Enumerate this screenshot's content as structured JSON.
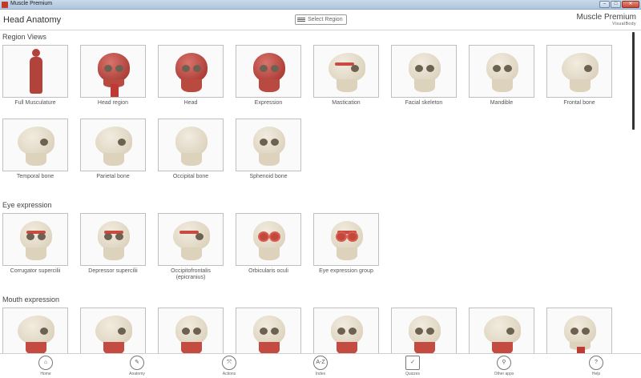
{
  "window": {
    "title": "Muscle Premium",
    "buttons": [
      "–",
      "□",
      "✕"
    ]
  },
  "header": {
    "page_title": "Head Anatomy",
    "region_select": "Select Region",
    "brand_name": "Muscle Premium",
    "brand_sub": "VisualBody"
  },
  "sections": {
    "region_views": {
      "title": "Region Views",
      "tiles": [
        "Full Musculature",
        "Head region",
        "Head",
        "Expression",
        "Mastication",
        "Facial skeleton",
        "Mandible",
        "Frontal bone",
        "Temporal bone",
        "Parietal bone",
        "Occipital bone",
        "Sphenoid bone"
      ]
    },
    "eye_expression": {
      "title": "Eye expression",
      "tiles": [
        "Corrugator supercilii",
        "Depressor supercilii",
        "Occipitofrontalis (epicranius)",
        "Orbicularis oculi",
        "Eye expression group"
      ]
    },
    "mouth_expression": {
      "title": "Mouth expression"
    }
  },
  "bottom_nav": {
    "items": [
      {
        "label": "Home",
        "icon": "home-icon",
        "glyph": "⌂"
      },
      {
        "label": "Anatomy",
        "icon": "anatomy-icon",
        "glyph": "✎"
      },
      {
        "label": "Actions",
        "icon": "actions-icon",
        "glyph": "⤧"
      },
      {
        "label": "Index",
        "icon": "index-icon",
        "glyph": "A-Z"
      },
      {
        "label": "Quizzes",
        "icon": "quizzes-icon",
        "glyph": "✓"
      },
      {
        "label": "Other apps",
        "icon": "other-apps-icon",
        "glyph": "⚲"
      },
      {
        "label": "Help",
        "icon": "help-icon",
        "glyph": "?"
      }
    ]
  },
  "colors": {
    "accent_muscle": "#b2433b",
    "bone": "#e6dcc8",
    "border": "#bfbfbf"
  }
}
